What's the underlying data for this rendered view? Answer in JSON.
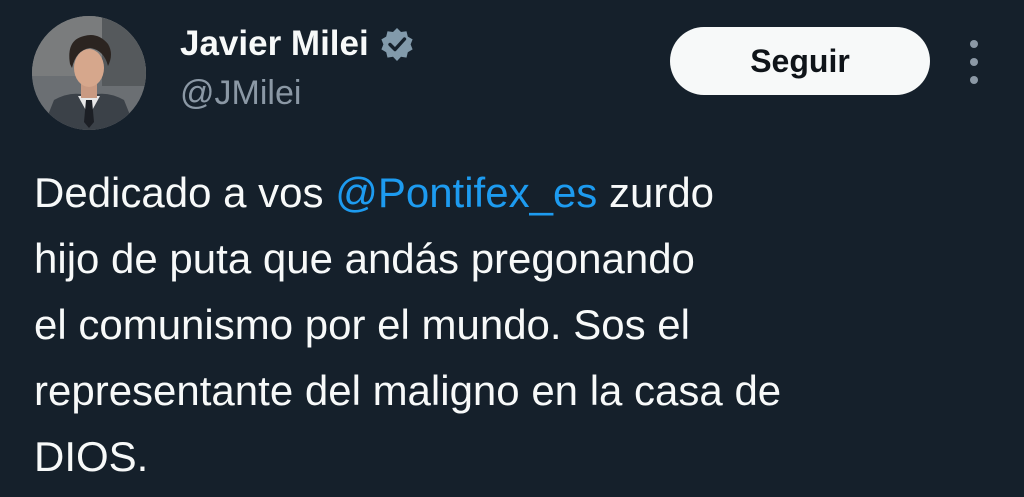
{
  "author": {
    "display_name": "Javier Milei",
    "handle": "@JMilei",
    "verified": true,
    "avatar_icon": "profile-photo"
  },
  "actions": {
    "follow_label": "Seguir",
    "more_icon": "more-options-icon"
  },
  "tweet": {
    "line1_before": "Dedicado a vos ",
    "mention": "@Pontifex_es",
    "line1_after": " zurdo",
    "line2": "hijo de puta que andás pregonando",
    "line3": "el comunismo por el mundo. Sos el",
    "line4": "representante del maligno en la casa de",
    "line5": "DIOS."
  },
  "colors": {
    "background": "#15202b",
    "text": "#f7f9f9",
    "secondary": "#8b98a5",
    "link": "#1d9bf0",
    "follow_bg": "#f7f9f9"
  }
}
